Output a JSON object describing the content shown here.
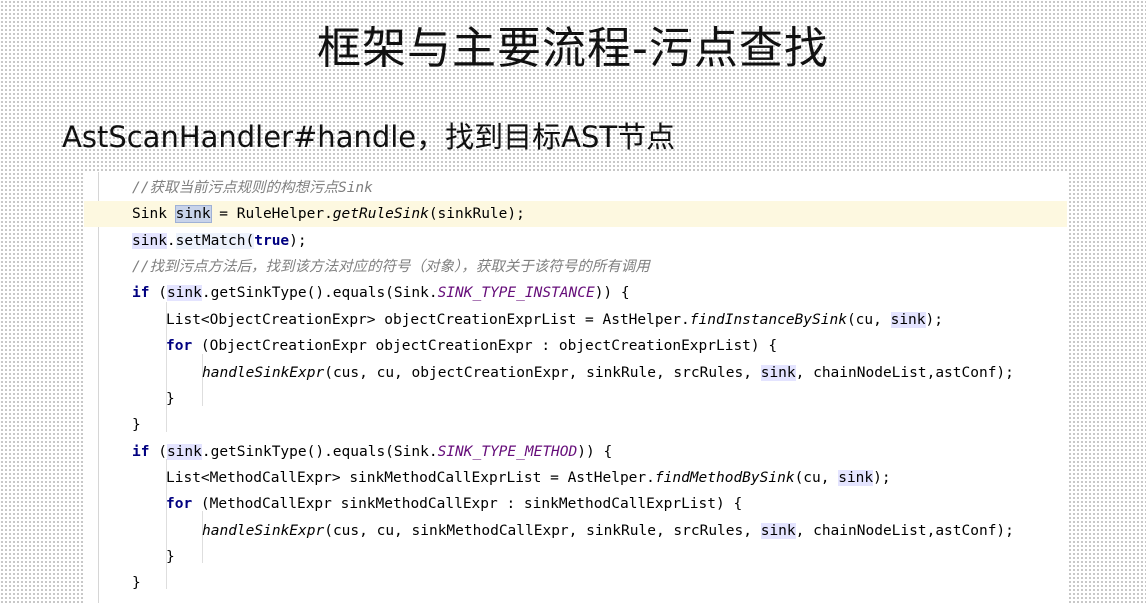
{
  "slide": {
    "title": "框架与主要流程-污点查找",
    "subtitle": "AstScanHandler#handle，找到目标AST节点"
  },
  "code": {
    "line1": {
      "comment": "//获取当前污点规则的构想污点",
      "comment_italic": "Sink"
    },
    "line2": {
      "a": "Sink ",
      "var": "sink",
      "b": " = RuleHelper.",
      "call": "getRuleSink",
      "c": "(sinkRule);"
    },
    "line3": {
      "var": "sink",
      "dot": ".",
      "method": "setMatch",
      "open": "(",
      "kw": "true",
      "close": ");"
    },
    "line4": {
      "comment": "//找到污点方法后，找到该方法对应的符号（对象），获取关于该符号的所有调用"
    },
    "line5": {
      "kw": "if",
      "a": " (",
      "var": "sink",
      "b": ".getSinkType().equals(Sink.",
      "const": "SINK_TYPE_INSTANCE",
      "c": ")) {"
    },
    "line6": {
      "a": "List<ObjectCreationExpr> objectCreationExprList = AstHelper.",
      "call": "findInstanceBySink",
      "b": "(cu, ",
      "var": "sink",
      "c": ");"
    },
    "line7": {
      "kw": "for",
      "a": " (ObjectCreationExpr objectCreationExpr : objectCreationExprList) {"
    },
    "line8": {
      "call": "handleSinkExpr",
      "a": "(cus, cu, objectCreationExpr, sinkRule, srcRules, ",
      "var": "sink",
      "b": ", chainNodeList,astConf);"
    },
    "line9": {
      "a": "}"
    },
    "line10": {
      "a": "}"
    },
    "line11": {
      "kw": "if",
      "a": " (",
      "var": "sink",
      "b": ".getSinkType().equals(Sink.",
      "const": "SINK_TYPE_METHOD",
      "c": ")) {"
    },
    "line12": {
      "a": "List<MethodCallExpr> sinkMethodCallExprList = AstHelper.",
      "call": "findMethodBySink",
      "b": "(cu, ",
      "var": "sink",
      "c": ");"
    },
    "line13": {
      "kw": "for",
      "a": " (MethodCallExpr sinkMethodCallExpr : sinkMethodCallExprList) {"
    },
    "line14": {
      "call": "handleSinkExpr",
      "a": "(cus, cu, sinkMethodCallExpr, sinkRule, srcRules, ",
      "var": "sink",
      "b": ", chainNodeList,astConf);"
    },
    "line15": {
      "a": "}"
    },
    "line16": {
      "a": "}"
    }
  },
  "colors": {
    "keyword": "#000080",
    "static_constant": "#660e7a",
    "comment": "#7f7f7f",
    "current_line": "#fdf8e0",
    "usage_highlight": "#e4e4ff",
    "selection_highlight": "#c8d3ea"
  }
}
